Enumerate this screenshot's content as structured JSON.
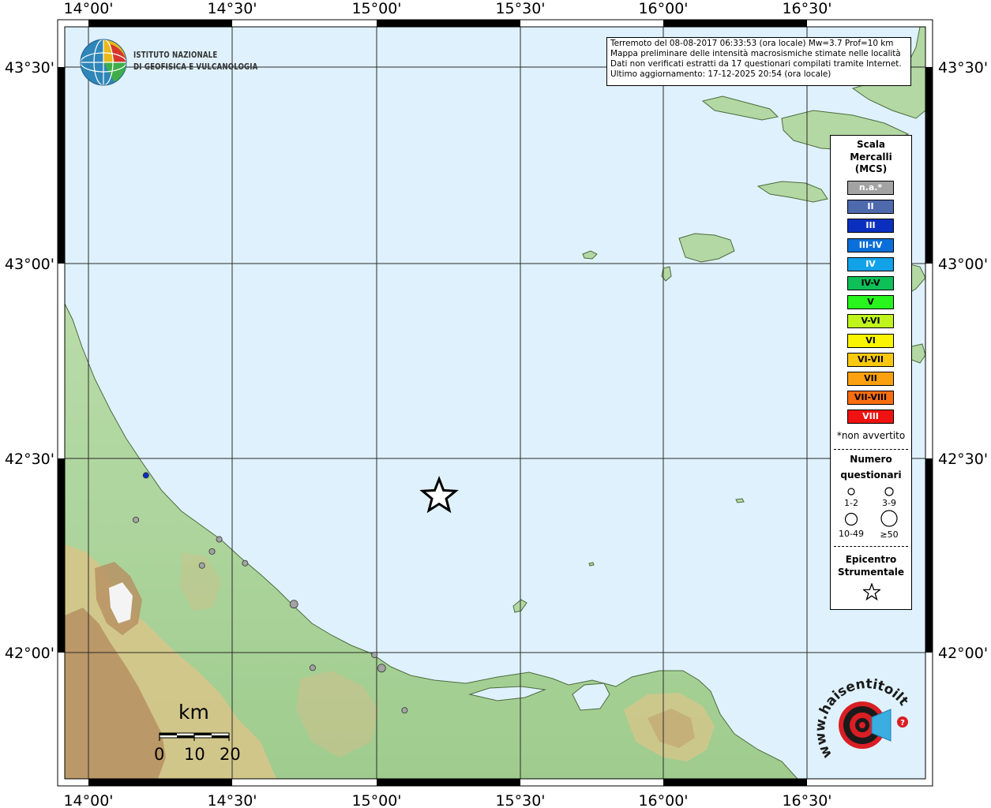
{
  "map": {
    "lon_labels": [
      "14°00'",
      "14°30'",
      "15°00'",
      "15°30'",
      "16°00'",
      "16°30'"
    ],
    "lat_labels": [
      "43°30'",
      "43°00'",
      "42°30'",
      "42°00'"
    ],
    "colors": {
      "sea": "#dff1fc",
      "lowland": "#a9d39a",
      "hills": "#d7c58a",
      "mountains": "#b48c5e",
      "grid": "#2a2a2a",
      "frame": "#000000"
    }
  },
  "info_box": {
    "line1": "Terremoto del 08-08-2017 06:33:53 (ora locale) Mw=3.7 Prof=10 km",
    "line2": "Mappa preliminare delle intensità macrosismiche stimate nelle località",
    "line3": "Dati non verificati estratti da 17 questionari compilati tramite Internet.",
    "line4": "Ultimo aggiornamento: 17-12-2025 20:54 (ora locale)"
  },
  "logo_ingv": {
    "line1": "ISTITUTO NAZIONALE",
    "line2": "DI GEOFISICA E VULCANOLOGIA"
  },
  "legend": {
    "title1": "Scala",
    "title2": "Mercalli",
    "title3": "(MCS)",
    "intensities": [
      {
        "label": "n.a.*",
        "color": "#a3a3a3",
        "text_color": "#ffffff"
      },
      {
        "label": "II",
        "color": "#4f69ad",
        "text_color": "#ffffff"
      },
      {
        "label": "III",
        "color": "#0a2fbf",
        "text_color": "#ffffff"
      },
      {
        "label": "III-IV",
        "color": "#0a6fd9",
        "text_color": "#ffffff"
      },
      {
        "label": "IV",
        "color": "#11a2e8",
        "text_color": "#ffffff"
      },
      {
        "label": "IV-V",
        "color": "#0fbf57",
        "text_color": "#000000"
      },
      {
        "label": "V",
        "color": "#28f51d",
        "text_color": "#000000"
      },
      {
        "label": "V-VI",
        "color": "#bff51d",
        "text_color": "#000000"
      },
      {
        "label": "VI",
        "color": "#f9f500",
        "text_color": "#000000"
      },
      {
        "label": "VI-VII",
        "color": "#fac90f",
        "text_color": "#000000"
      },
      {
        "label": "VII",
        "color": "#fba10f",
        "text_color": "#000000"
      },
      {
        "label": "VII-VIII",
        "color": "#f96d0f",
        "text_color": "#000000"
      },
      {
        "label": "VIII",
        "color": "#f01111",
        "text_color": "#ffffff"
      }
    ],
    "not_felt_note": "*non avvertito",
    "count_title1": "Numero",
    "count_title2": "questionari",
    "count_classes": [
      "1-2",
      "3-9",
      "10-49",
      "≥50"
    ],
    "epicenter_title1": "Epicentro",
    "epicenter_title2": "Strumentale"
  },
  "scale_bar": {
    "unit": "km",
    "ticks": [
      "0",
      "10",
      "20"
    ]
  },
  "logo_hst": {
    "text": "www.haisentitoilterremoto.it"
  },
  "observations": [
    {
      "lon": 14.2,
      "lat": 42.454,
      "intensity": "III",
      "questionnaires": "1-2"
    },
    {
      "lon": 14.165,
      "lat": 42.34,
      "intensity": "n.a.*",
      "questionnaires": "1-2"
    },
    {
      "lon": 14.455,
      "lat": 42.29,
      "intensity": "n.a.*",
      "questionnaires": "1-2"
    },
    {
      "lon": 14.43,
      "lat": 42.259,
      "intensity": "n.a.*",
      "questionnaires": "1-2"
    },
    {
      "lon": 14.395,
      "lat": 42.223,
      "intensity": "n.a.*",
      "questionnaires": "1-2"
    },
    {
      "lon": 14.545,
      "lat": 42.229,
      "intensity": "n.a.*",
      "questionnaires": "1-2"
    },
    {
      "lon": 14.715,
      "lat": 42.124,
      "intensity": "n.a.*",
      "questionnaires": "3-9"
    },
    {
      "lon": 14.78,
      "lat": 41.961,
      "intensity": "n.a.*",
      "questionnaires": "1-2"
    },
    {
      "lon": 14.995,
      "lat": 41.994,
      "intensity": "n.a.*",
      "questionnaires": "1-2"
    },
    {
      "lon": 15.02,
      "lat": 41.96,
      "intensity": "n.a.*",
      "questionnaires": "3-9"
    },
    {
      "lon": 15.1,
      "lat": 41.852,
      "intensity": "n.a.*",
      "questionnaires": "1-2"
    }
  ],
  "epicenter": {
    "lon": 15.22,
    "lat": 42.4
  }
}
